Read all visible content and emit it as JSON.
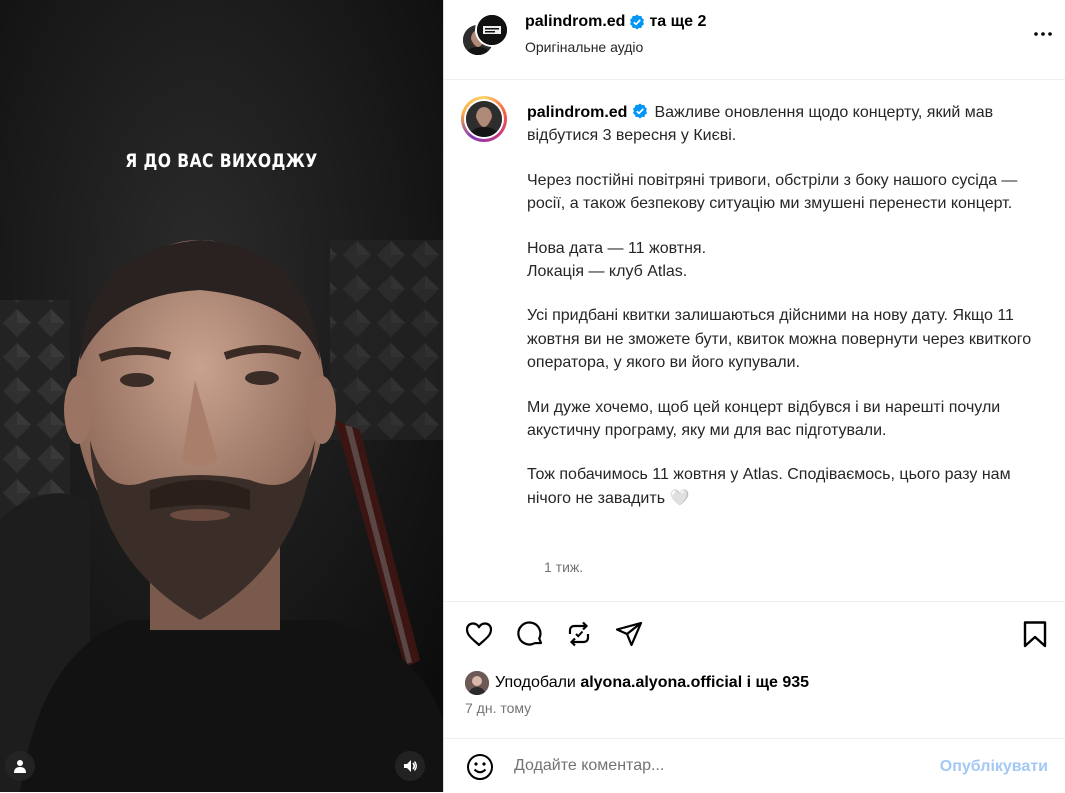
{
  "media": {
    "overlay_text": "Я ДО ВАС ВИХОДЖУ"
  },
  "header": {
    "username": "palindrom.ed",
    "coauthors": "та ще 2",
    "audio": "Оригінальне аудіо"
  },
  "caption": {
    "username": "palindrom.ed",
    "paragraphs": [
      "Важливе оновлення щодо концерту, який мав відбутися 3 вересня у Києві.",
      "Через постійні повітряні тривоги, обстріли з боку нашого сусіда — росії, а також безпекову ситуацію ми змушені перенести концерт.",
      "Нова дата — 11 жовтня.\nЛокація — клуб Atlas.",
      "Усі придбані квитки залишаються дійсними на нову дату. Якщо 11 жовтня ви не зможете бути, квиток можна повернути через квиткого оператора, у якого ви його купували.",
      "Ми дуже хочемо, щоб цей концерт відбувся і ви нарешті почули акустичну програму, яку ми для вас підготували.",
      "Тож побачимось 11 жовтня у Atlas. Сподіваємось, цього разу нам нічого не завадить 🤍"
    ],
    "time": "1 тиж."
  },
  "likes": {
    "prefix": "Уподобали",
    "user": "alyona.alyona.official",
    "suffix": "і ще 935"
  },
  "post_date": "7 дн. тому",
  "comment": {
    "placeholder": "Додайте коментар...",
    "post_label": "Опублікувати"
  },
  "colors": {
    "verified": "#0095f6",
    "post_button_disabled": "#a3c8f5",
    "secondary_text": "#737373"
  }
}
